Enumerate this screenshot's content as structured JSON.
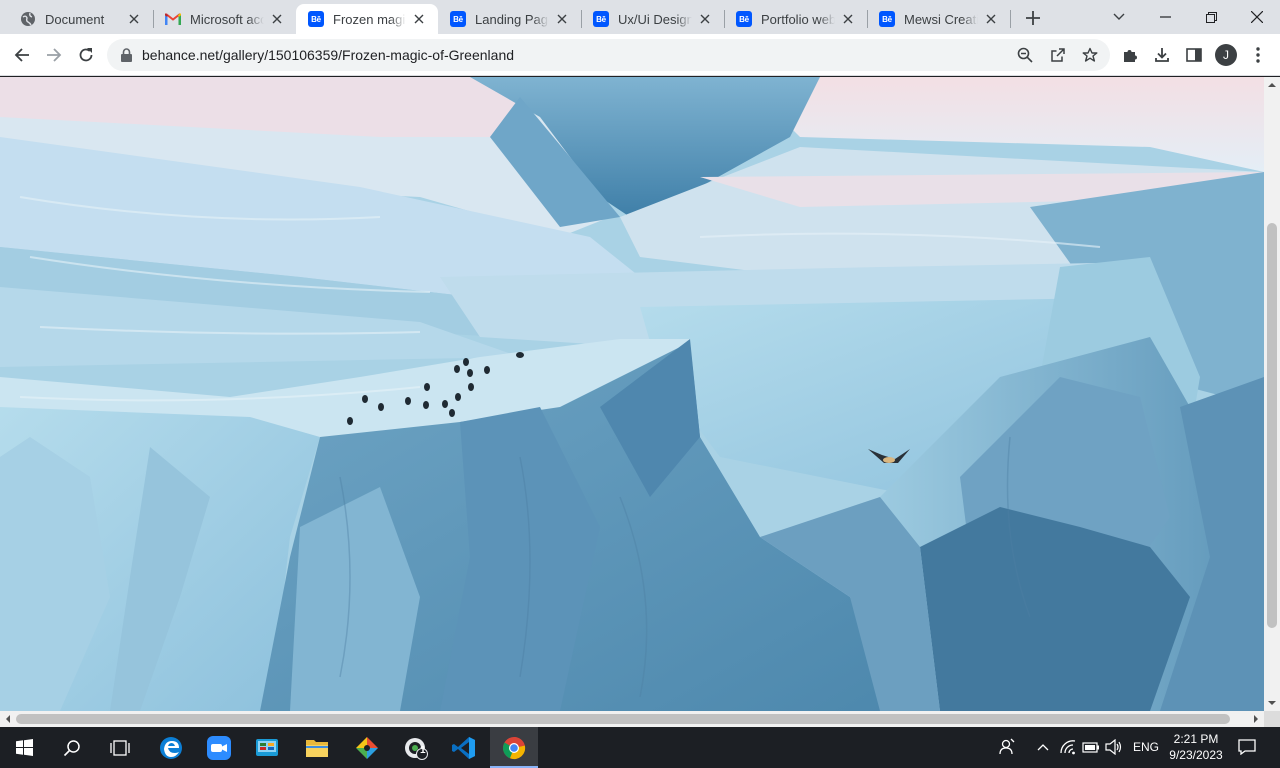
{
  "browser": {
    "tabs": [
      {
        "title": "Document",
        "icon": "globe-icon",
        "active": false
      },
      {
        "title": "Microsoft acco",
        "icon": "gmail-icon",
        "active": false
      },
      {
        "title": "Frozen magic o",
        "icon": "behance-icon",
        "active": true
      },
      {
        "title": "Landing Page -",
        "icon": "behance-icon",
        "active": false
      },
      {
        "title": "Ux/Ui Designer",
        "icon": "behance-icon",
        "active": false
      },
      {
        "title": "Portfolio websi",
        "icon": "behance-icon",
        "active": false
      },
      {
        "title": "Mewsi Creative",
        "icon": "behance-icon",
        "active": false
      }
    ],
    "behance_badge": "Bē",
    "profile_initial": "J",
    "url": "behance.net/gallery/150106359/Frozen-magic-of-Greenland",
    "colors": {
      "tabstrip": "#dee1e6",
      "toolbar": "#ffffff",
      "omnibox": "#f1f3f4",
      "behance_blue": "#0057ff",
      "taskbar": "#1c1f24"
    }
  },
  "page": {
    "content": "photograph of a large blue iceberg with a flock of birds resting on top and one bird in flight"
  },
  "taskbar": {
    "apps": [
      {
        "name": "Edge",
        "icon": "edge-icon",
        "active": false
      },
      {
        "name": "Zoom",
        "icon": "zoom-icon",
        "active": false
      },
      {
        "name": "Control Panel",
        "icon": "control-panel-icon",
        "active": false
      },
      {
        "name": "File Explorer",
        "icon": "folder-icon",
        "active": false
      },
      {
        "name": "Git",
        "icon": "git-icon",
        "active": false
      },
      {
        "name": "Chat",
        "icon": "chat-icon",
        "active": false,
        "badge": "1"
      },
      {
        "name": "VS Code",
        "icon": "vscode-icon",
        "active": false
      },
      {
        "name": "Chrome",
        "icon": "chrome-icon",
        "active": true
      }
    ],
    "tray": {
      "language": "ENG",
      "time": "2:21 PM",
      "date": "9/23/2023"
    }
  }
}
